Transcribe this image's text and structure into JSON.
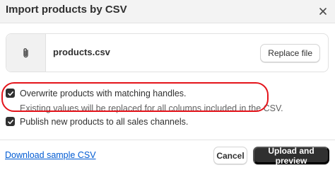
{
  "modal": {
    "title": "Import products by CSV",
    "close_icon": "close-icon"
  },
  "file": {
    "icon": "paperclip-icon",
    "name": "products.csv",
    "replace_label": "Replace file"
  },
  "options": [
    {
      "label": "Overwrite products with matching handles.",
      "help": "Existing values will be replaced for all columns included in the CSV.",
      "checked": true,
      "highlighted": true
    },
    {
      "label": "Publish new products to all sales channels.",
      "checked": true,
      "highlighted": false
    }
  ],
  "footer": {
    "download_link": "Download sample CSV",
    "cancel_label": "Cancel",
    "upload_label": "Upload and preview"
  },
  "colors": {
    "primary_button": "#303030",
    "link": "#005bd3",
    "highlight_ring": "#e4141b",
    "header_bg": "#f3f3f3"
  }
}
